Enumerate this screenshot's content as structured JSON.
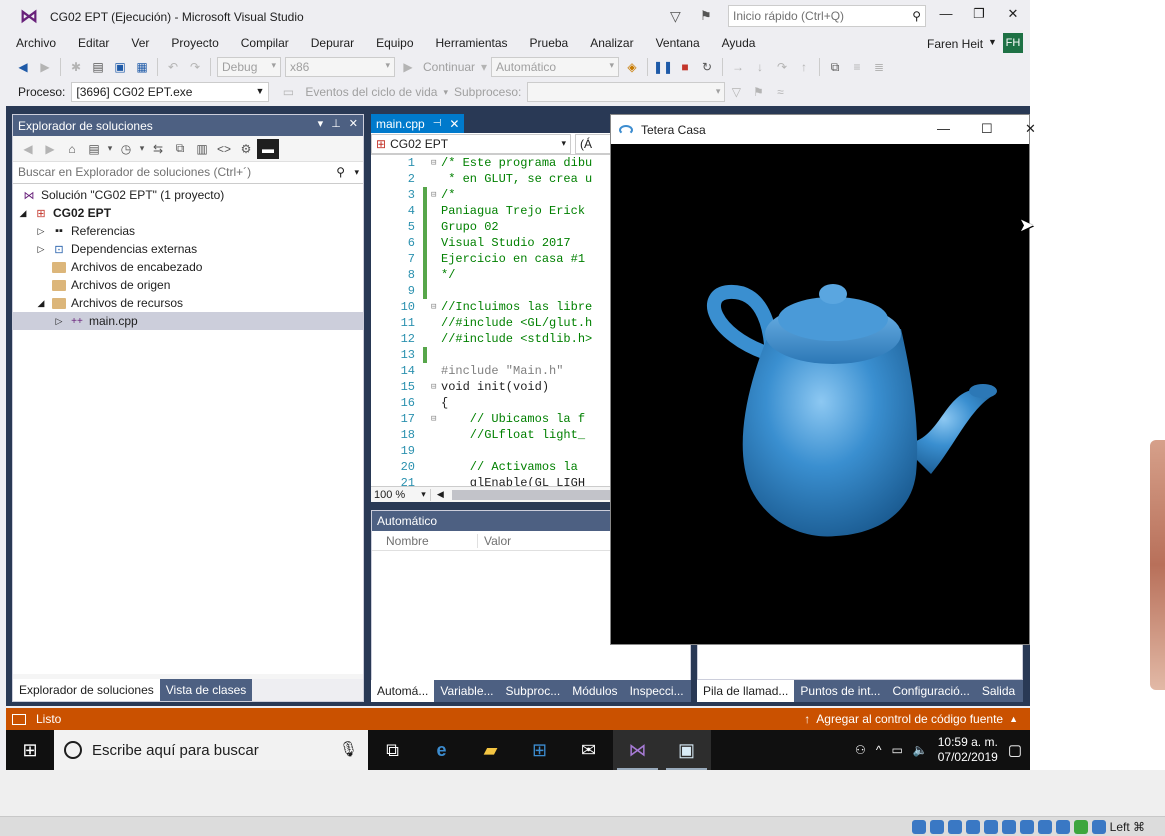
{
  "window": {
    "title": "CG02 EPT (Ejecución) - Microsoft Visual Studio",
    "quick_launch_placeholder": "Inicio rápido (Ctrl+Q)",
    "user_name": "Faren Heit",
    "user_initials": "FH"
  },
  "menu": [
    "Archivo",
    "Editar",
    "Ver",
    "Proyecto",
    "Compilar",
    "Depurar",
    "Equipo",
    "Herramientas",
    "Prueba",
    "Analizar",
    "Ventana",
    "Ayuda"
  ],
  "toolbar": {
    "config": "Debug",
    "platform": "x86",
    "continue_label": "Continuar",
    "automatic": "Automático"
  },
  "toolbar2": {
    "process_label": "Proceso:",
    "process_value": "[3696] CG02 EPT.exe",
    "lifecycle_label": "Eventos del ciclo de vida",
    "subprocess_label": "Subproceso:"
  },
  "solution_explorer": {
    "title": "Explorador de soluciones",
    "search_placeholder": "Buscar en Explorador de soluciones (Ctrl+´)",
    "tree": {
      "solution": "Solución \"CG02 EPT\"  (1 proyecto)",
      "project": "CG02 EPT",
      "references": "Referencias",
      "external_deps": "Dependencias externas",
      "header_files": "Archivos de encabezado",
      "source_files": "Archivos de origen",
      "resource_files": "Archivos de recursos",
      "main_file": "main.cpp"
    },
    "tabs": [
      "Explorador de soluciones",
      "Vista de clases"
    ]
  },
  "editor": {
    "tab_label": "main.cpp",
    "scope": "CG02 EPT",
    "scope2": "(Á",
    "zoom": "100 %",
    "lines": [
      {
        "n": "1",
        "text": "/* Este programa dibu"
      },
      {
        "n": "2",
        "text": " * en GLUT, se crea u"
      },
      {
        "n": "3",
        "text": "/*"
      },
      {
        "n": "4",
        "text": "Paniagua Trejo Erick"
      },
      {
        "n": "5",
        "text": "Grupo 02"
      },
      {
        "n": "6",
        "text": "Visual Studio 2017"
      },
      {
        "n": "7",
        "text": "Ejercicio en casa #1"
      },
      {
        "n": "8",
        "text": "*/"
      },
      {
        "n": "9",
        "text": ""
      },
      {
        "n": "10",
        "text": "//Incluimos las libre"
      },
      {
        "n": "11",
        "text": "//#include <GL/glut.h"
      },
      {
        "n": "12",
        "text": "//#include <stdlib.h>"
      },
      {
        "n": "13",
        "text": ""
      },
      {
        "n": "14",
        "text": "#include \"Main.h\""
      },
      {
        "n": "15",
        "text": "void init(void)"
      },
      {
        "n": "16",
        "text": "{"
      },
      {
        "n": "17",
        "text": "    // Ubicamos la f"
      },
      {
        "n": "18",
        "text": "    //GLfloat light_"
      },
      {
        "n": "19",
        "text": ""
      },
      {
        "n": "20",
        "text": "    // Activamos la"
      },
      {
        "n": "21",
        "text": "    glEnable(GL_LIGH"
      }
    ]
  },
  "auto_window": {
    "title": "Automático",
    "col_name": "Nombre",
    "col_value": "Valor"
  },
  "bottom_tabs_left": [
    "Automá...",
    "Variable...",
    "Subproc...",
    "Módulos",
    "Inspecci..."
  ],
  "bottom_tabs_right": [
    "Pila de llamad...",
    "Puntos de int...",
    "Configuració...",
    "Salida"
  ],
  "status": {
    "ready": "Listo",
    "source_control": "Agregar al control de código fuente"
  },
  "glut_window": {
    "title": "Tetera Casa",
    "teapot_color": "#3a8fd0"
  },
  "taskbar": {
    "search_placeholder": "Escribe aquí para buscar",
    "time": "10:59 a. m.",
    "date": "07/02/2019"
  },
  "vbox": {
    "host_key": "Left ⌘"
  }
}
